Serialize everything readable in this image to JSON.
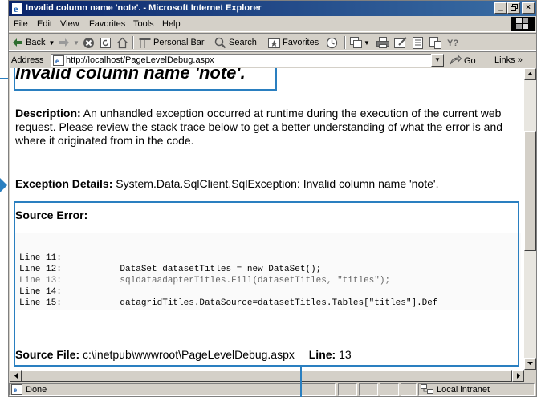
{
  "window": {
    "title": "Invalid column name 'note'. - Microsoft Internet Explorer",
    "min_label": "_",
    "max_label": "×",
    "restore_label": "❐",
    "close_label": "×"
  },
  "menu": [
    "File",
    "Edit",
    "View",
    "Favorites",
    "Tools",
    "Help"
  ],
  "toolbar": {
    "back": "Back",
    "personal_bar": "Personal Bar",
    "search": "Search",
    "favorites": "Favorites"
  },
  "address": {
    "label": "Address",
    "url": "http://localhost/PageLevelDebug.aspx",
    "go": "Go",
    "links": "Links »"
  },
  "page": {
    "heading": "Invalid column name 'note'.",
    "description_label": "Description:",
    "description_text": " An unhandled exception occurred at runtime during the execution of the current web request. Please review the stack trace below to get a better understanding of what the error is and where it originated from in the code.",
    "exception_label": "Exception Details:",
    "exception_text": " System.Data.SqlClient.SqlException: Invalid column name 'note'.",
    "source_error_label": "Source Error:",
    "code_lines": [
      "Line 11:",
      "Line 12:           DataSet datasetTitles = new DataSet();",
      "Line 13:           sqldataadapterTitles.Fill(datasetTitles, \"titles\");",
      "Line 14:",
      "Line 15:           datagridTitles.DataSource=datasetTitles.Tables[\"titles\"].Def"
    ],
    "source_file_label": "Source File:",
    "source_file_value": " c:\\inetpub\\wwwroot\\PageLevelDebug.aspx",
    "line_label": "Line:",
    "line_value": " 13"
  },
  "status": {
    "text": "Done",
    "zone": "Local intranet"
  },
  "colors": {
    "titlebar_start": "#0a246a",
    "titlebar_end": "#3a6ea5",
    "callout": "#2a7fc0",
    "chrome": "#d4d0c8"
  }
}
